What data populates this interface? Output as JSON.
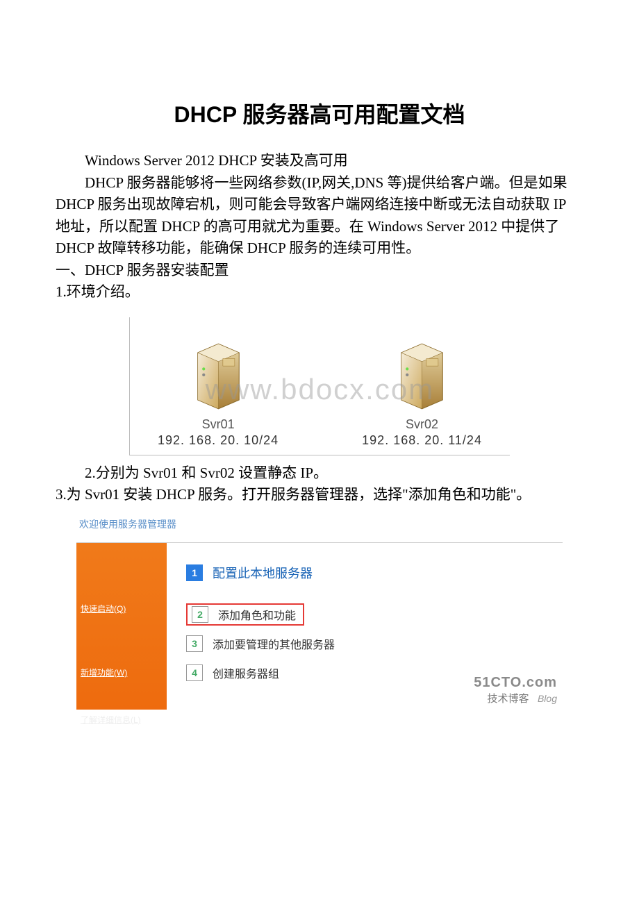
{
  "title": "DHCP 服务器高可用配置文档",
  "subtitle": "Windows Server 2012 DHCP 安装及高可用",
  "intro": "DHCP 服务器能够将一些网络参数(IP,网关,DNS 等)提供给客户端。但是如果 DHCP 服务出现故障宕机，则可能会导致客户端网络连接中断或无法自动获取 IP 地址，所以配置 DHCP 的高可用就尤为重要。在 Windows Server 2012 中提供了 DHCP 故障转移功能，能确保 DHCP 服务的连续可用性。",
  "section1": "一、DHCP 服务器安装配置",
  "step1": "1.环境介绍。",
  "servers": [
    {
      "name": "Svr01",
      "ip": "192. 168. 20. 10/24"
    },
    {
      "name": "Svr02",
      "ip": "192. 168. 20. 11/24"
    }
  ],
  "watermark": "www.bdocx.com",
  "step2": "2.分别为 Svr01 和 Svr02 设置静态 IP。",
  "step3": "3.为 Svr01 安装 DHCP 服务。打开服务器管理器，选择\"添加角色和功能\"。",
  "sm": {
    "welcome": "欢迎使用服务器管理器",
    "side": {
      "quickstart": "快速启动(Q)",
      "newfeature": "新增功能(W)",
      "moreinfo": "了解详细信息(L)"
    },
    "items": [
      {
        "num": "1",
        "label": "配置此本地服务器",
        "active": true,
        "boxed": false
      },
      {
        "num": "2",
        "label": "添加角色和功能",
        "active": false,
        "boxed": true
      },
      {
        "num": "3",
        "label": "添加要管理的其他服务器",
        "active": false,
        "boxed": false
      },
      {
        "num": "4",
        "label": "创建服务器组",
        "active": false,
        "boxed": false
      }
    ],
    "brand1": "51CTO.com",
    "brand2": "技术博客",
    "brand3": "Blog"
  }
}
